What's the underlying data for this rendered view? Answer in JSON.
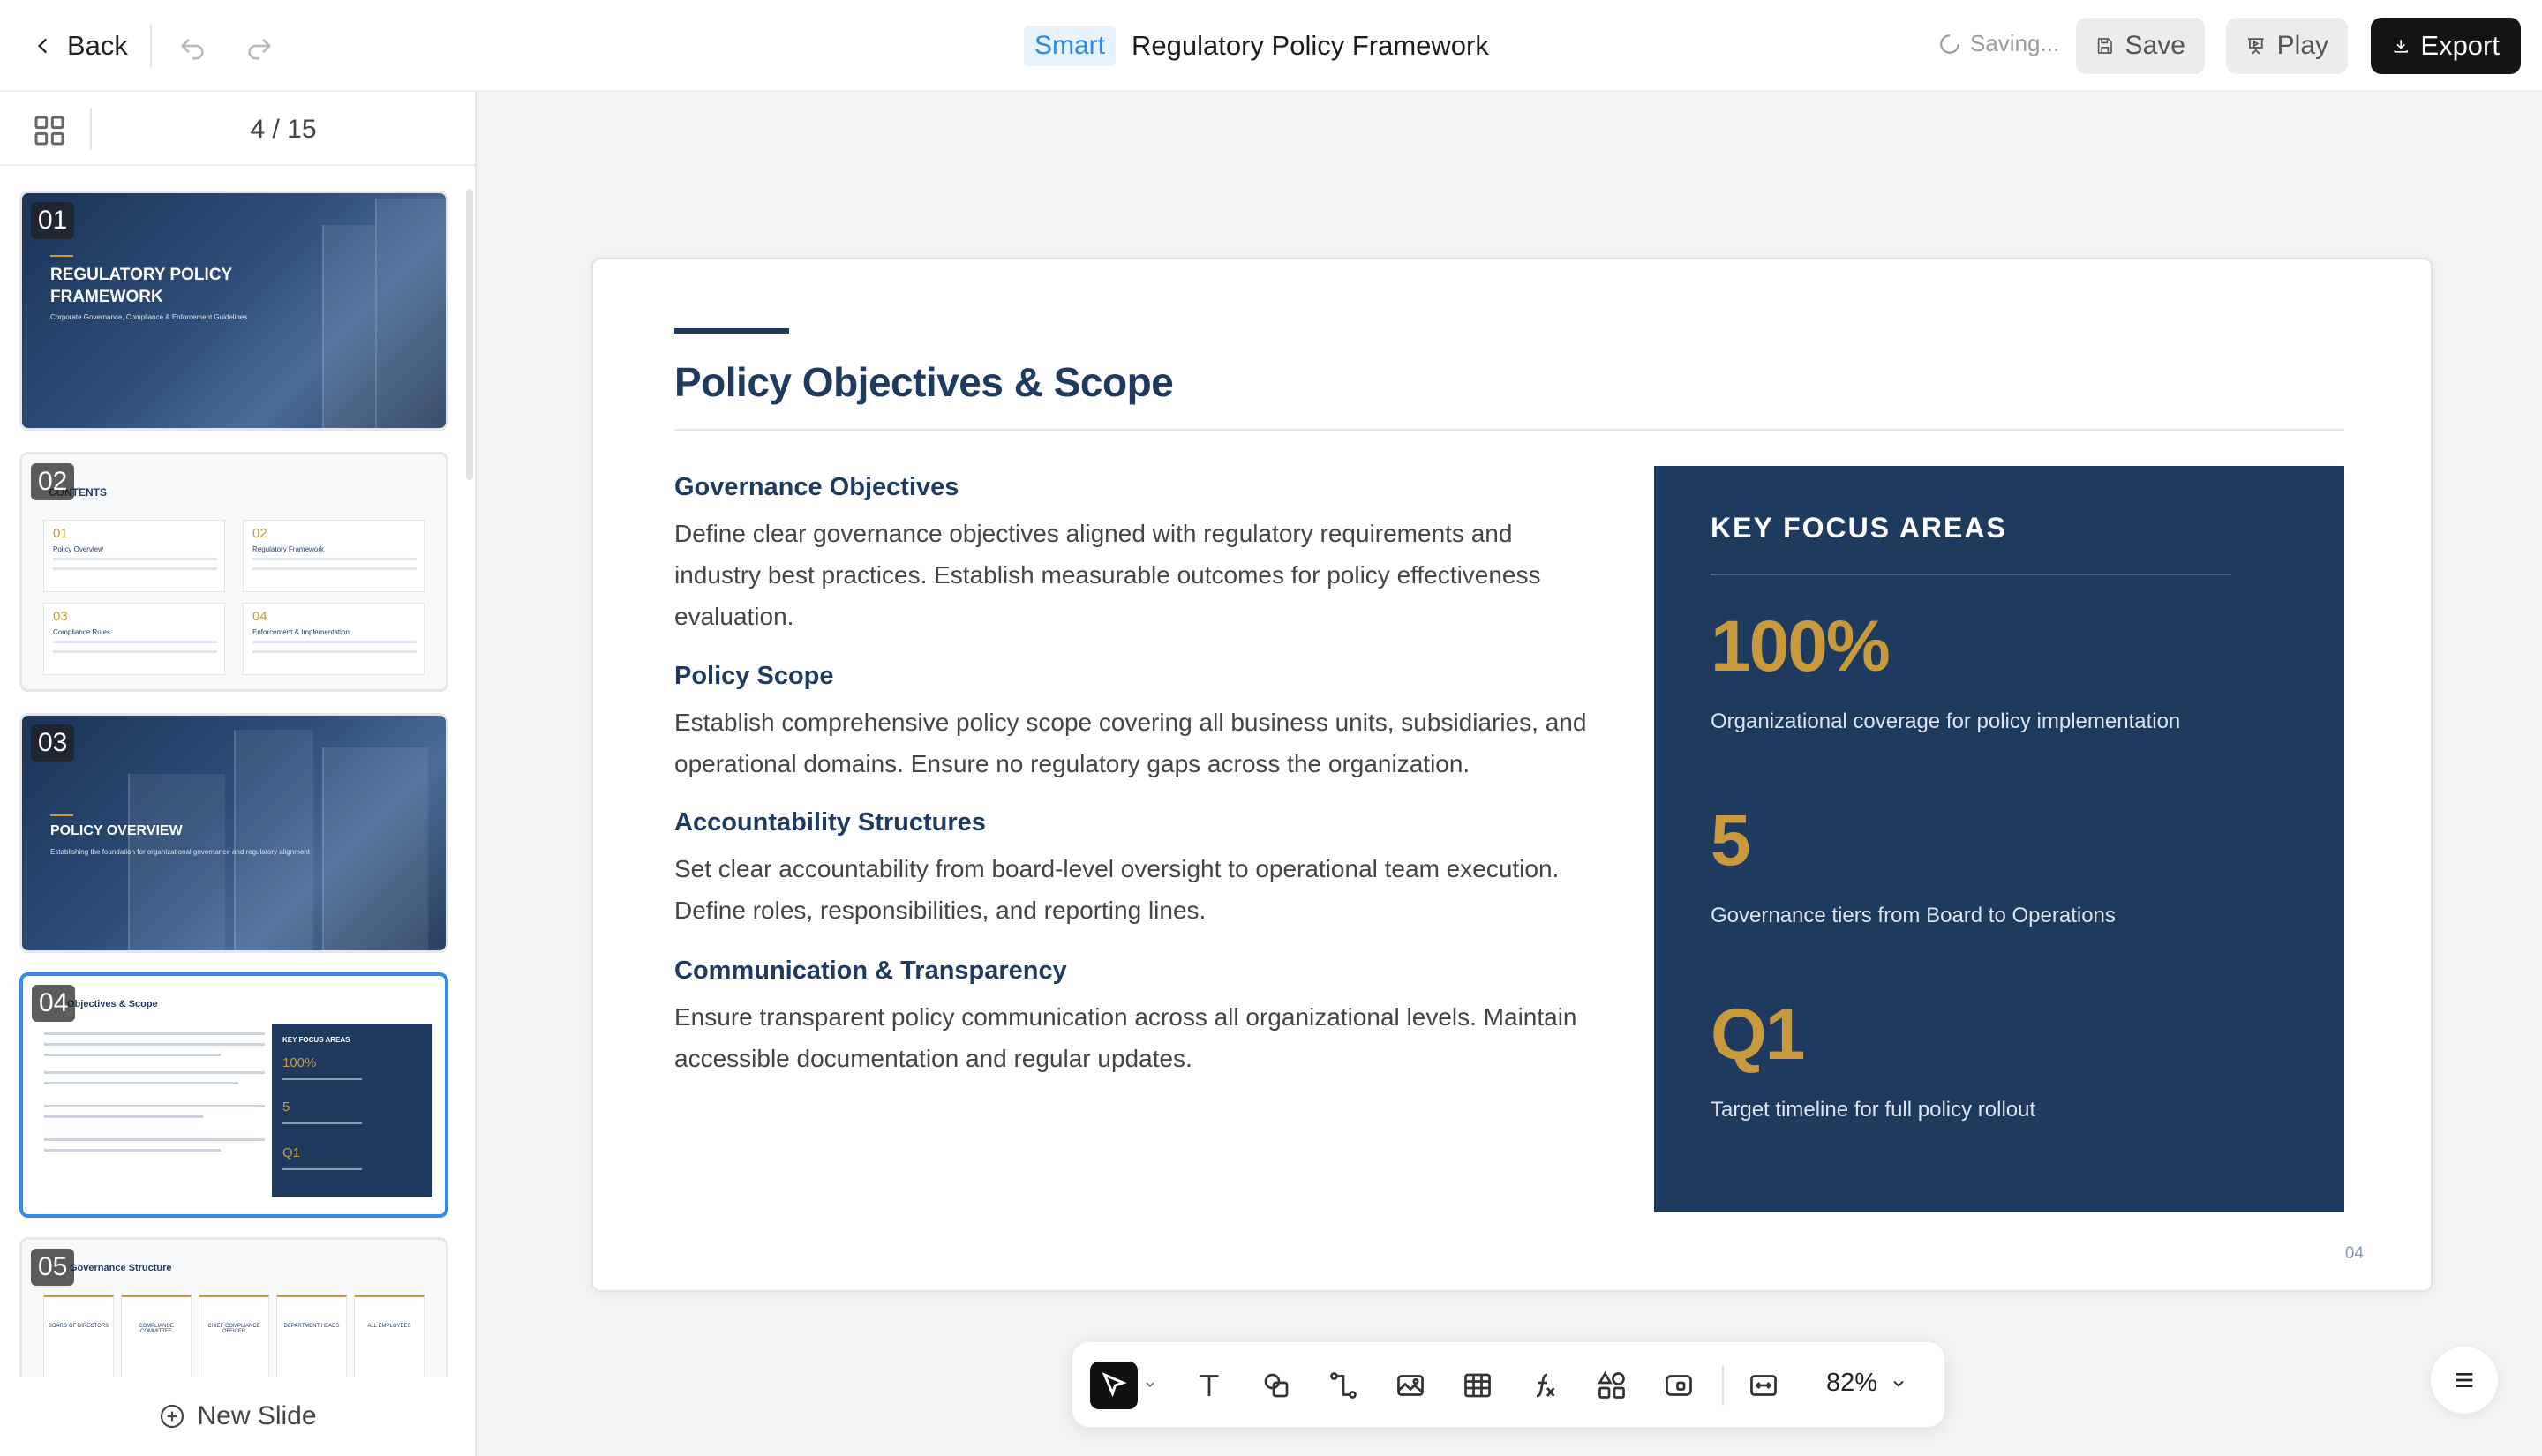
{
  "header": {
    "back_label": "Back",
    "smart_badge": "Smart",
    "doc_title": "Regulatory Policy Framework",
    "saving_status": "Saving...",
    "save_label": "Save",
    "play_label": "Play",
    "export_label": "Export"
  },
  "sidebar": {
    "page_counter": "4 / 15",
    "new_slide_label": "New Slide",
    "thumbnails": [
      {
        "num": "01",
        "title_line1": "REGULATORY POLICY",
        "title_line2": "FRAMEWORK",
        "subtitle": "Corporate Governance, Compliance & Enforcement Guidelines"
      },
      {
        "num": "02",
        "heading": "CONTENTS",
        "cards": [
          {
            "n": "01",
            "label": "Policy Overview"
          },
          {
            "n": "02",
            "label": "Regulatory Framework"
          },
          {
            "n": "03",
            "label": "Compliance Rules"
          },
          {
            "n": "04",
            "label": "Enforcement & Implementation"
          }
        ]
      },
      {
        "num": "03",
        "title": "POLICY OVERVIEW",
        "subtitle": "Establishing the foundation for organizational governance and regulatory alignment"
      },
      {
        "num": "04",
        "heading": "Objectives & Scope",
        "panel_title": "KEY FOCUS AREAS",
        "panel_values": [
          "100%",
          "5",
          "Q1"
        ]
      },
      {
        "num": "05",
        "heading": "Governance Structure",
        "columns": [
          "BOARD OF DIRECTORS",
          "COMPLIANCE COMMITTEE",
          "CHIEF COMPLIANCE OFFICER",
          "DEPARTMENT HEADS",
          "ALL EMPLOYEES"
        ]
      }
    ]
  },
  "slide": {
    "title": "Policy Objectives & Scope",
    "objectives": [
      {
        "title": "Governance Objectives",
        "body": "Define clear governance objectives aligned with regulatory requirements and industry best practices. Establish measurable outcomes for policy effectiveness evaluation."
      },
      {
        "title": "Policy Scope",
        "body": "Establish comprehensive policy scope covering all business units, subsidiaries, and operational domains. Ensure no regulatory gaps across the organization."
      },
      {
        "title": "Accountability Structures",
        "body": "Set clear accountability from board-level oversight to operational team execution. Define roles, responsibilities, and reporting lines."
      },
      {
        "title": "Communication & Transparency",
        "body": "Ensure transparent policy communication across all organizational levels. Maintain accessible documentation and regular updates."
      }
    ],
    "focus": {
      "title": "KEY FOCUS AREAS",
      "items": [
        {
          "value": "100%",
          "desc": "Organizational coverage for policy implementation"
        },
        {
          "value": "5",
          "desc": "Governance tiers from Board to Operations"
        },
        {
          "value": "Q1",
          "desc": "Target timeline for full policy rollout"
        }
      ]
    },
    "page_number": "04"
  },
  "toolbar": {
    "zoom": "82%",
    "tools": [
      "select-tool",
      "text-tool",
      "shape-tool",
      "connector-tool",
      "image-tool",
      "table-tool",
      "formula-tool",
      "components-tool",
      "media-tool",
      "fit-screen-tool"
    ]
  },
  "colors": {
    "navy": "#1f3a5f",
    "gold": "#c99a3b",
    "accent_blue": "#2e8de6"
  }
}
